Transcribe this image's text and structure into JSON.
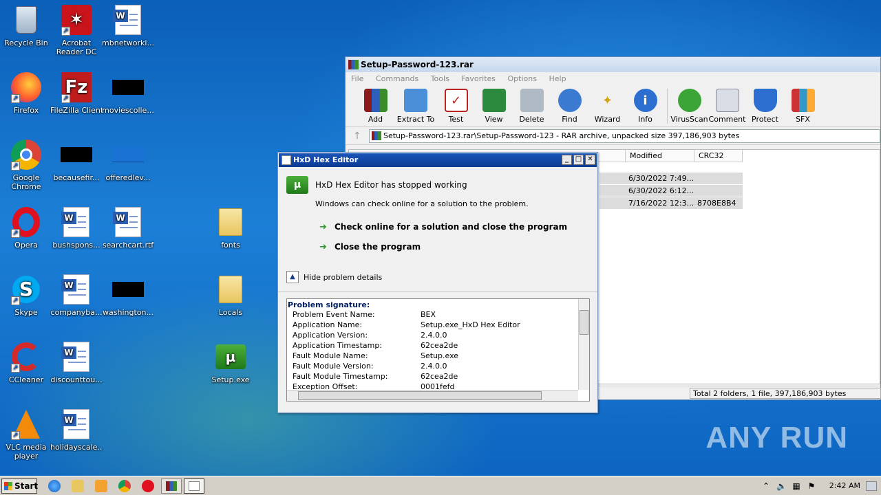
{
  "desktop": {
    "icons": [
      {
        "label": "Recycle Bin"
      },
      {
        "label": "Acrobat Reader DC"
      },
      {
        "label": "mbnetworki..."
      },
      {
        "label": "Firefox"
      },
      {
        "label": "FileZilla Client"
      },
      {
        "label": "moviescolle..."
      },
      {
        "label": "Google Chrome"
      },
      {
        "label": "becausefir..."
      },
      {
        "label": "offeredlev..."
      },
      {
        "label": "Opera"
      },
      {
        "label": "bushspons..."
      },
      {
        "label": "searchcart.rtf"
      },
      {
        "label": "fonts"
      },
      {
        "label": "Skype"
      },
      {
        "label": "companyba..."
      },
      {
        "label": "washington..."
      },
      {
        "label": "Locals"
      },
      {
        "label": "CCleaner"
      },
      {
        "label": "discounttou..."
      },
      {
        "label": "Setup.exe"
      },
      {
        "label": "VLC media player"
      },
      {
        "label": "holidayscale..."
      }
    ]
  },
  "winrar": {
    "title": "Setup-Password-123.rar",
    "menu": [
      "File",
      "Commands",
      "Tools",
      "Favorites",
      "Options",
      "Help"
    ],
    "toolbar": [
      "Add",
      "Extract To",
      "Test",
      "View",
      "Delete",
      "Find",
      "Wizard",
      "Info",
      "VirusScan",
      "Comment",
      "Protect",
      "SFX"
    ],
    "path": "Setup-Password-123.rar\\Setup-Password-123 - RAR archive, unpacked size 397,186,903 bytes",
    "columns": {
      "modified": "Modified",
      "crc": "CRC32"
    },
    "rows": [
      {
        "modified": "6/30/2022 7:49...",
        "crc": ""
      },
      {
        "modified": "6/30/2022 6:12...",
        "crc": ""
      },
      {
        "modified": "7/16/2022 12:3...",
        "crc": "8708E8B4"
      }
    ],
    "status": "Total 2 folders, 1 file, 397,186,903 bytes"
  },
  "dialog": {
    "title": "HxD Hex Editor",
    "heading": "HxD Hex Editor has stopped working",
    "subtext": "Windows can check online for a solution to the problem.",
    "option1": "Check online for a solution and close the program",
    "option2": "Close the program",
    "toggle": "Hide problem details",
    "details_header": "Problem signature:",
    "details": [
      {
        "k": "Problem Event Name:",
        "v": "BEX"
      },
      {
        "k": "Application Name:",
        "v": "Setup.exe_HxD Hex Editor"
      },
      {
        "k": "Application Version:",
        "v": "2.4.0.0"
      },
      {
        "k": "Application Timestamp:",
        "v": "62cea2de"
      },
      {
        "k": "Fault Module Name:",
        "v": "Setup.exe"
      },
      {
        "k": "Fault Module Version:",
        "v": "2.4.0.0"
      },
      {
        "k": "Fault Module Timestamp:",
        "v": "62cea2de"
      },
      {
        "k": "Exception Offset:",
        "v": "0001fefd"
      }
    ]
  },
  "taskbar": {
    "start": "Start",
    "clock": "2:42 AM"
  },
  "watermark": "ANY RUN"
}
